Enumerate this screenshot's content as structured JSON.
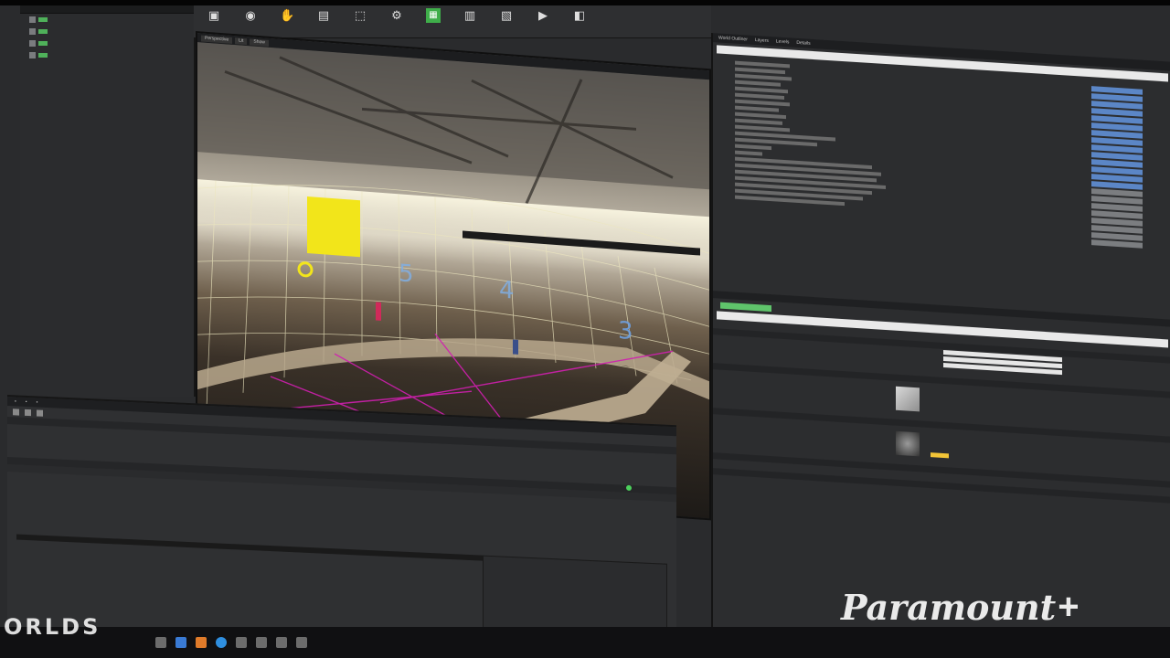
{
  "toolbar": {
    "buttons": [
      {
        "icon": "save-icon",
        "label": ""
      },
      {
        "icon": "source-control-icon",
        "label": ""
      },
      {
        "icon": "modes-icon",
        "label": ""
      },
      {
        "icon": "content-icon",
        "label": ""
      },
      {
        "icon": "marketplace-icon",
        "label": ""
      },
      {
        "icon": "settings-icon",
        "label": ""
      },
      {
        "icon": "blueprints-icon",
        "label": ""
      },
      {
        "icon": "build-icon",
        "label": ""
      },
      {
        "icon": "cinematics-icon",
        "label": ""
      },
      {
        "icon": "play-icon",
        "label": ""
      },
      {
        "icon": "launch-icon",
        "label": ""
      }
    ]
  },
  "viewport": {
    "tabs": [
      "Perspective",
      "Lit",
      "Show"
    ]
  },
  "right_panel": {
    "tabs": [
      "World Outliner",
      "Layers",
      "Levels",
      "Details"
    ]
  },
  "watermarks": {
    "left": "ORLDS",
    "right": "Paramount",
    "right_plus": "+"
  },
  "colors": {
    "accent_green": "#4fb15a",
    "selection_blue": "#5b86c6",
    "viewport_yellow": "#f2e51a",
    "wireframe": "#e8e3c0",
    "magenta": "#d11fb0"
  }
}
